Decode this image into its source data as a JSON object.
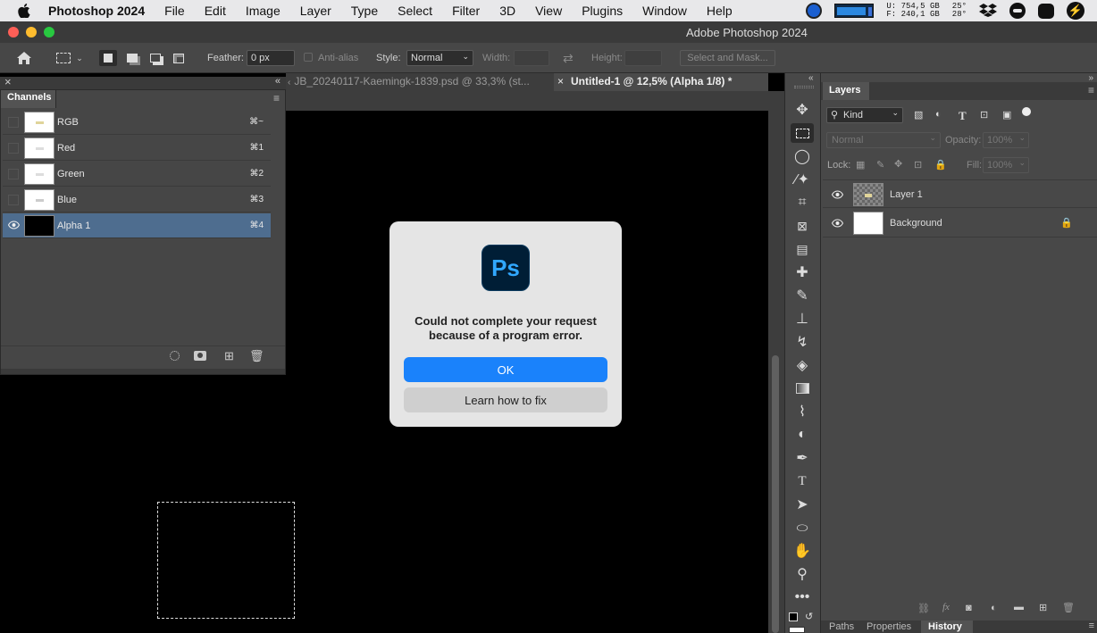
{
  "menubar": {
    "app_name": "Photoshop 2024",
    "items": [
      "File",
      "Edit",
      "Image",
      "Layer",
      "Type",
      "Select",
      "Filter",
      "3D",
      "View",
      "Plugins",
      "Window",
      "Help"
    ],
    "disk_u": "U:  754,5 GB",
    "disk_f": "F:  240,1 GB",
    "temp1": "25°",
    "temp2": "28°"
  },
  "titlebar": {
    "title": "Adobe Photoshop 2024"
  },
  "options": {
    "feather_label": "Feather:",
    "feather_value": "0 px",
    "antialias_label": "Anti-alias",
    "style_label": "Style:",
    "style_value": "Normal",
    "width_label": "Width:",
    "height_label": "Height:",
    "select_mask_label": "Select and Mask..."
  },
  "tabs": [
    {
      "label": "JB_20240117-Kaemingk-1839.psd @ 33,3% (st..."
    },
    {
      "label": "Untitled-1 @ 12,5% (Alpha 1/8) *"
    }
  ],
  "channels": {
    "title": "Channels",
    "rows": [
      {
        "name": "RGB",
        "key": "⌘~"
      },
      {
        "name": "Red",
        "key": "⌘1"
      },
      {
        "name": "Green",
        "key": "⌘2"
      },
      {
        "name": "Blue",
        "key": "⌘3"
      },
      {
        "name": "Alpha 1",
        "key": "⌘4"
      }
    ]
  },
  "layers": {
    "title": "Layers",
    "kind_label": "Kind",
    "blend_mode": "Normal",
    "opacity_label": "Opacity:",
    "opacity_value": "100%",
    "lock_label": "Lock:",
    "fill_label": "Fill:",
    "fill_value": "100%",
    "rows": [
      {
        "name": "Layer 1"
      },
      {
        "name": "Background"
      }
    ],
    "bottom_tabs": [
      "Paths",
      "Properties",
      "History"
    ]
  },
  "dialog": {
    "logo_text": "Ps",
    "message": "Could not complete your request because of a program error.",
    "ok_label": "OK",
    "fix_label": "Learn how to fix"
  }
}
